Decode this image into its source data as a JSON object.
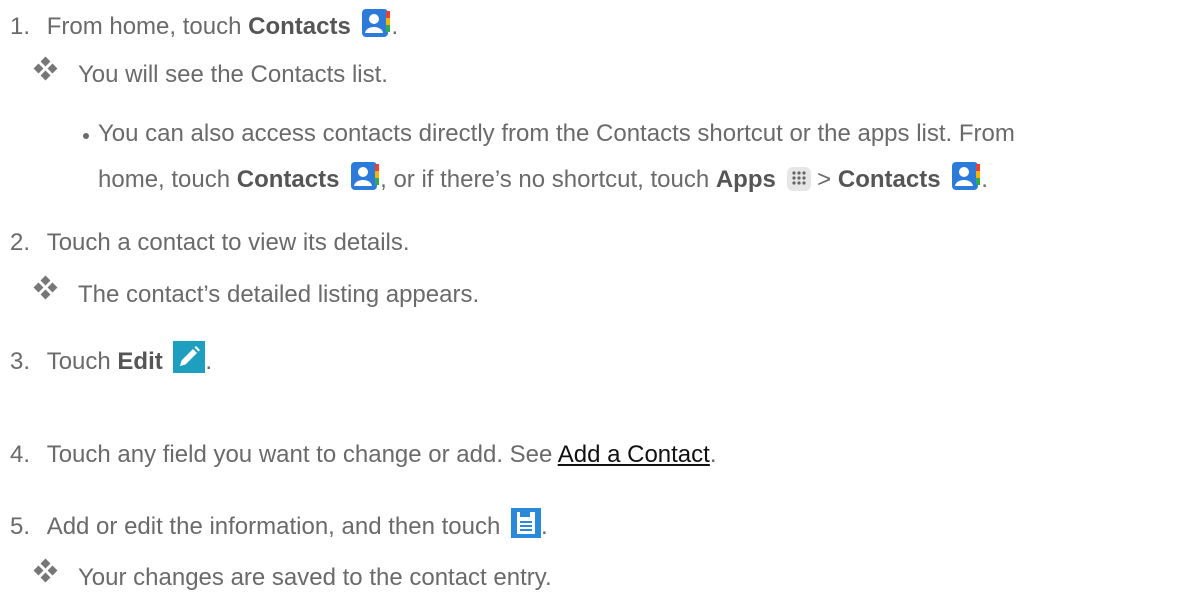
{
  "step1": {
    "number": "1.",
    "prefix": "From home, touch ",
    "bold": "Contacts",
    "suffix": ".",
    "result": "You will see the Contacts list.",
    "note_line1": "You can also access contacts directly from the Contacts shortcut or the apps list. From",
    "note_line2_prefix": "home, touch ",
    "note_contacts1": "Contacts",
    "note_mid": ", or if there’s no shortcut, touch ",
    "note_apps": "Apps",
    "note_gt": " > ",
    "note_contacts2": "Contacts",
    "note_end": "."
  },
  "step2": {
    "number": "2.",
    "text": "Touch a contact to view its details.",
    "result": "The contact’s detailed listing appears."
  },
  "step3": {
    "number": "3.",
    "prefix": "Touch ",
    "bold": "Edit",
    "suffix": "."
  },
  "step4": {
    "number": "4.",
    "text": "Touch any field you want to change or add. See ",
    "link": "Add a Contact",
    "suffix": "."
  },
  "step5": {
    "number": "5.",
    "text": "Add or edit the information, and then touch ",
    "suffix": ".",
    "result": "Your changes are saved to the contact entry."
  },
  "icons": {
    "contacts": "contacts-app-icon",
    "apps": "apps-grid-icon",
    "edit": "pencil-edit-icon",
    "save": "save-icon"
  },
  "colors": {
    "contacts_blue": "#2d7bd8",
    "edit_teal": "#1e9fbf",
    "save_blue": "#2a8ad9"
  }
}
